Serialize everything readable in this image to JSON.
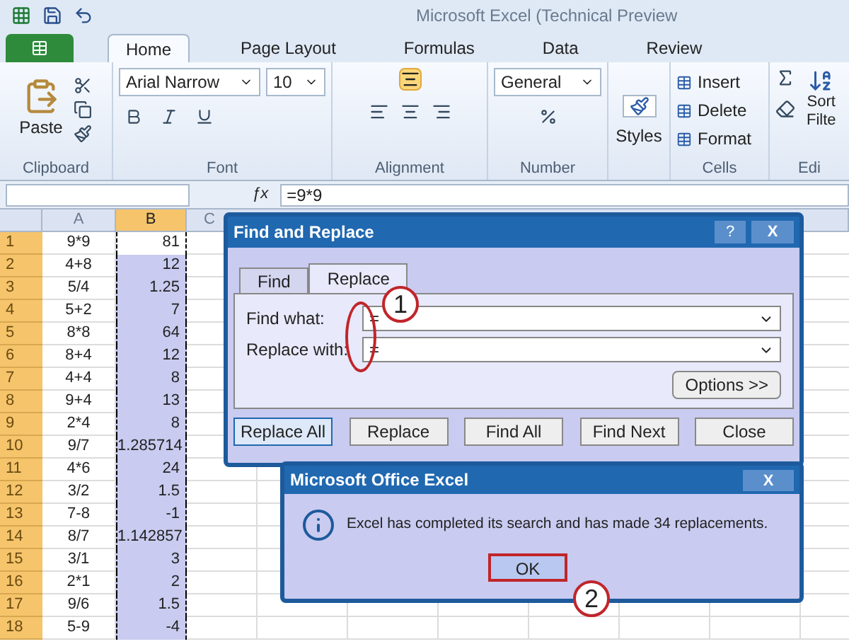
{
  "window": {
    "title": "Microsoft Excel (Technical Preview"
  },
  "ribbon_tabs": [
    {
      "label": "Home",
      "selected": true
    },
    {
      "label": "Page Layout",
      "selected": false
    },
    {
      "label": "Formulas",
      "selected": false
    },
    {
      "label": "Data",
      "selected": false
    },
    {
      "label": "Review",
      "selected": false
    }
  ],
  "ribbon": {
    "paste": "Paste",
    "font_name": "Arial Narrow",
    "font_size": "10",
    "number_format": "General",
    "styles": "Styles",
    "cells_buttons": [
      "Insert",
      "Delete",
      "Format"
    ],
    "sort_filter": [
      "Sort",
      "Filte"
    ],
    "groups": [
      "Clipboard",
      "Font",
      "Alignment",
      "Number",
      "Cells",
      "Edi"
    ]
  },
  "formula_bar": {
    "fx_label": "ƒx",
    "formula": "=9*9"
  },
  "sheet": {
    "columns": [
      {
        "label": "A",
        "selected": false
      },
      {
        "label": "B",
        "selected": true
      },
      {
        "label": "C",
        "selected": false
      }
    ],
    "rows": [
      {
        "n": "1",
        "a": "9*9",
        "b": "81"
      },
      {
        "n": "2",
        "a": "4+8",
        "b": "12"
      },
      {
        "n": "3",
        "a": "5/4",
        "b": "1.25"
      },
      {
        "n": "4",
        "a": "5+2",
        "b": "7"
      },
      {
        "n": "5",
        "a": "8*8",
        "b": "64"
      },
      {
        "n": "6",
        "a": "8+4",
        "b": "12"
      },
      {
        "n": "7",
        "a": "4+4",
        "b": "8"
      },
      {
        "n": "8",
        "a": "9+4",
        "b": "13"
      },
      {
        "n": "9",
        "a": "2*4",
        "b": "8"
      },
      {
        "n": "10",
        "a": "9/7",
        "b": "1.285714"
      },
      {
        "n": "11",
        "a": "4*6",
        "b": "24"
      },
      {
        "n": "12",
        "a": "3/2",
        "b": "1.5"
      },
      {
        "n": "13",
        "a": "7-8",
        "b": "-1"
      },
      {
        "n": "14",
        "a": "8/7",
        "b": "1.142857"
      },
      {
        "n": "15",
        "a": "3/1",
        "b": "3"
      },
      {
        "n": "16",
        "a": "2*1",
        "b": "2"
      },
      {
        "n": "17",
        "a": "9/6",
        "b": "1.5"
      },
      {
        "n": "18",
        "a": "5-9",
        "b": "-4"
      }
    ]
  },
  "find_replace": {
    "title": "Find and Replace",
    "help": "?",
    "close": "X",
    "tabs": [
      {
        "label": "Find",
        "selected": false
      },
      {
        "label": "Replace",
        "selected": true
      }
    ],
    "find_what": {
      "label": "Find what:",
      "value": "="
    },
    "replace_with": {
      "label": "Replace with:",
      "value": "="
    },
    "options": "Options >>",
    "buttons": [
      "Replace All",
      "Replace",
      "Find All",
      "Find Next",
      "Close"
    ]
  },
  "message_box": {
    "title": "Microsoft Office Excel",
    "close": "X",
    "message": "Excel has completed its search and has made 34 replacements.",
    "ok": "OK"
  },
  "callouts": [
    "1",
    "2"
  ]
}
